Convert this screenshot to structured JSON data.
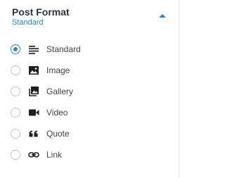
{
  "panel": {
    "title": "Post Format",
    "subtitle": "Standard",
    "toggle_icon": "chevron-up-icon"
  },
  "formats": [
    {
      "label": "Standard",
      "icon": "standard-icon",
      "selected": true
    },
    {
      "label": "Image",
      "icon": "image-icon",
      "selected": false
    },
    {
      "label": "Gallery",
      "icon": "gallery-icon",
      "selected": false
    },
    {
      "label": "Video",
      "icon": "video-icon",
      "selected": false
    },
    {
      "label": "Quote",
      "icon": "quote-icon",
      "selected": false
    },
    {
      "label": "Link",
      "icon": "link-icon",
      "selected": false
    }
  ],
  "colors": {
    "accent": "#2a86c2",
    "title": "#2c3338",
    "label": "#3c434a",
    "icon": "#1e1e1e",
    "radio_border": "#c3c4c7"
  }
}
